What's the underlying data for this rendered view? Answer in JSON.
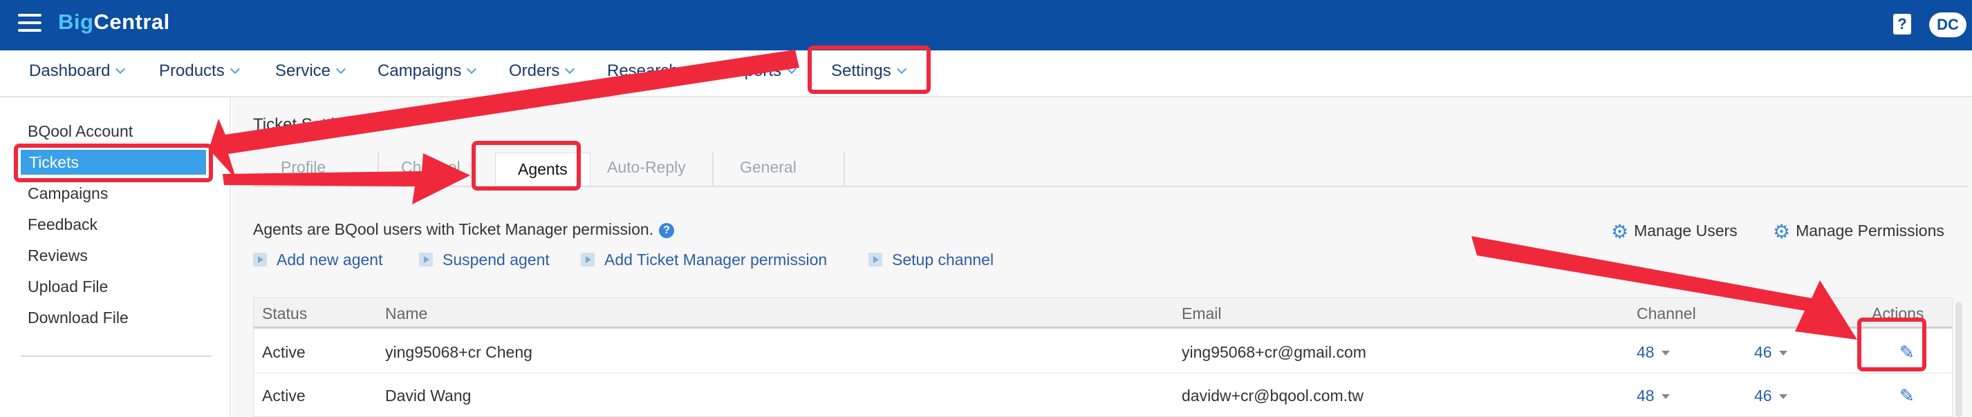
{
  "app": {
    "logo_part1": "Big",
    "logo_part2": "Central",
    "help_label": "?",
    "user_initials": "DC"
  },
  "nav": {
    "items": [
      {
        "label": "Dashboard"
      },
      {
        "label": "Products"
      },
      {
        "label": "Service"
      },
      {
        "label": "Campaigns"
      },
      {
        "label": "Orders"
      },
      {
        "label": "Research"
      },
      {
        "label": "Reports"
      },
      {
        "label": "Settings"
      }
    ]
  },
  "sidebar": {
    "items": [
      {
        "label": "BQool Account"
      },
      {
        "label": "Tickets"
      },
      {
        "label": "Campaigns"
      },
      {
        "label": "Feedback"
      },
      {
        "label": "Reviews"
      },
      {
        "label": "Upload File"
      },
      {
        "label": "Download File"
      }
    ]
  },
  "page": {
    "title": "Ticket Settings"
  },
  "tabs": [
    {
      "label": "Profile"
    },
    {
      "label": "Channel"
    },
    {
      "label": "Agents"
    },
    {
      "label": "Auto-Reply"
    },
    {
      "label": "General"
    }
  ],
  "agents": {
    "description": "Agents are BQool users with Ticket Manager permission.",
    "info_icon": "?",
    "manage_users": "Manage Users",
    "manage_permissions": "Manage Permissions",
    "actions": [
      {
        "label": "Add new agent"
      },
      {
        "label": "Suspend agent"
      },
      {
        "label": "Add Ticket Manager permission"
      },
      {
        "label": "Setup channel"
      }
    ]
  },
  "table": {
    "headers": {
      "status": "Status",
      "name": "Name",
      "email": "Email",
      "channel": "Channel",
      "actions": "Actions"
    },
    "rows": [
      {
        "status": "Active",
        "name": "ying95068+cr Cheng",
        "email": "ying95068+cr@gmail.com",
        "channel": "48",
        "tickets": "46"
      },
      {
        "status": "Active",
        "name": "David Wang",
        "email": "davidw+cr@bqool.com.tw",
        "channel": "48",
        "tickets": "46"
      }
    ]
  },
  "colors": {
    "header_bg": "#0b4ea2",
    "accent": "#3aa0e8",
    "link": "#2a5ea8",
    "annotation": "#f0283c"
  }
}
